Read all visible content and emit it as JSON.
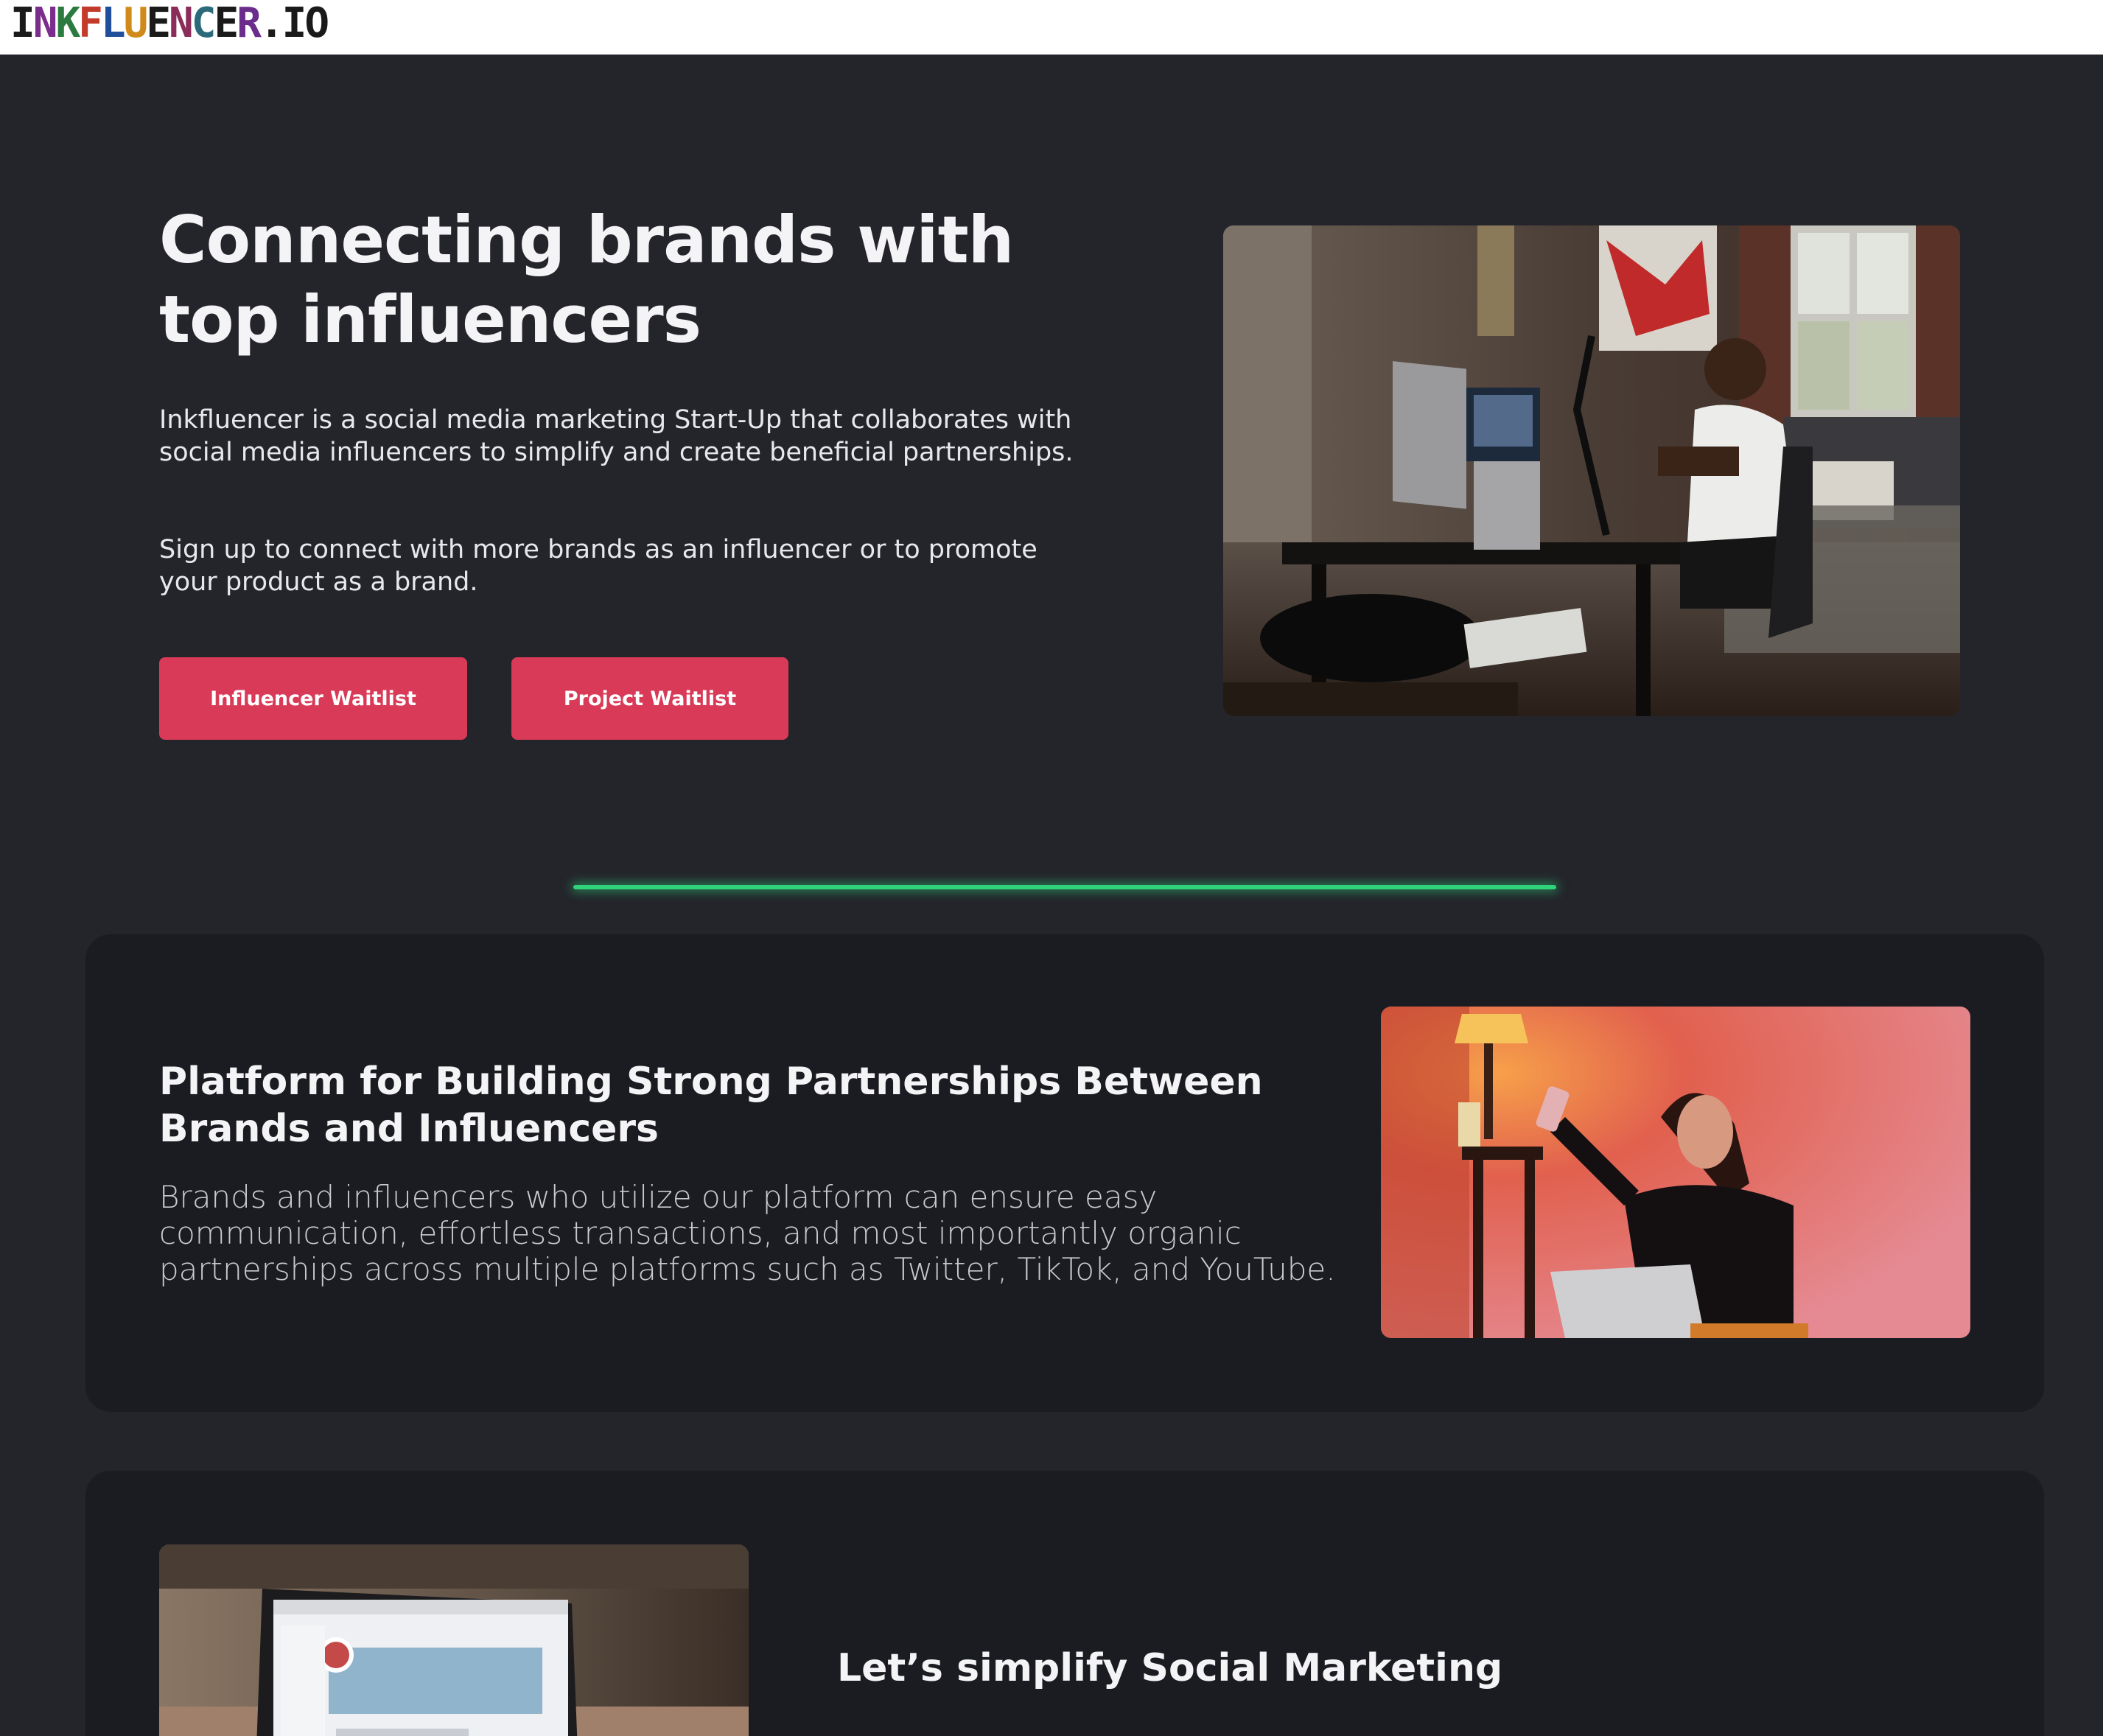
{
  "header": {
    "logo_text": "INKFLUENCER.IO",
    "logo_colors": [
      "#1a1a1a",
      "#7a2d8c",
      "#2b7a3f",
      "#c23a2a",
      "#1f4f9c",
      "#d08a1a",
      "#1a1a1a",
      "#8a2d5a",
      "#2b6a7a",
      "#1a1a1a",
      "#6a2d8c",
      "#1a1a1a",
      "#1a1a1a",
      "#1a1a1a"
    ]
  },
  "hero": {
    "title": "Connecting brands with top influencers",
    "paragraph_1": "Inkfluencer is a social media marketing Start-Up that collaborates with social media influencers to simplify and create beneficial partnerships.",
    "paragraph_2": "Sign up to connect with more brands as an influencer or to promote your product as a brand.",
    "influencer_button": "Influencer Waitlist",
    "project_button": "Project Waitlist",
    "image": "creator-at-desk-photo"
  },
  "features": [
    {
      "title": "Platform for Building Strong Partnerships Between Brands and Influencers",
      "text": "Brands and influencers who utilize our platform can ensure easy communication, effortless transactions, and most importantly organic partnerships across multiple platforms such as Twitter, TikTok, and YouTube.",
      "image": "influencer-selfie-photo"
    },
    {
      "title": "Let’s simplify Social Marketing",
      "text": "",
      "image": "laptop-social-feed-photo"
    }
  ],
  "colors": {
    "background": "#24252b",
    "card": "#1b1c21",
    "accent": "#d83a57",
    "divider": "#2ed37a"
  }
}
